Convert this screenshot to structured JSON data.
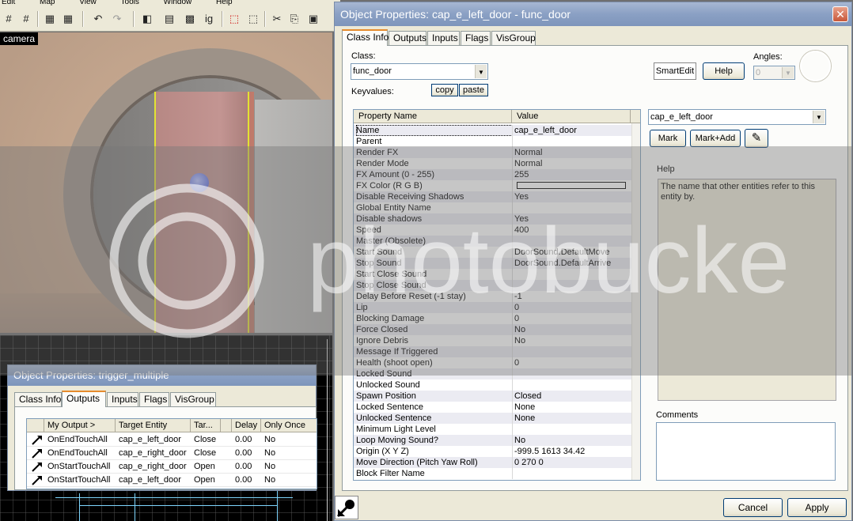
{
  "hammer": {
    "menu": [
      "Edit",
      "Map",
      "View",
      "Tools",
      "Window",
      "Help"
    ],
    "camera_label": "camera"
  },
  "main_dialog": {
    "title": "Object Properties: cap_e_left_door - func_door",
    "tabs": [
      {
        "label": "Class Info",
        "active": true
      },
      {
        "label": "Outputs",
        "active": false
      },
      {
        "label": "Inputs",
        "active": false
      },
      {
        "label": "Flags",
        "active": false
      },
      {
        "label": "VisGroup",
        "active": false
      }
    ],
    "class_label": "Class:",
    "class_value": "func_door",
    "keyvalues_label": "Keyvalues:",
    "copy_label": "copy",
    "paste_label": "paste",
    "smartedit_label": "SmartEdit",
    "help_button_label": "Help",
    "angles_label": "Angles:",
    "angles_value": "0",
    "column_property": "Property Name",
    "column_value": "Value",
    "properties": [
      {
        "name": "Name",
        "value": "cap_e_left_door"
      },
      {
        "name": "Parent",
        "value": ""
      },
      {
        "name": "Render FX",
        "value": "Normal"
      },
      {
        "name": "Render Mode",
        "value": "Normal"
      },
      {
        "name": "FX Amount (0 - 255)",
        "value": "255"
      },
      {
        "name": "FX Color (R G B)",
        "value": ""
      },
      {
        "name": "Disable Receiving Shadows",
        "value": "Yes"
      },
      {
        "name": "Global Entity Name",
        "value": ""
      },
      {
        "name": "Disable shadows",
        "value": "Yes"
      },
      {
        "name": "Speed",
        "value": "400"
      },
      {
        "name": "Master (Obsolete)",
        "value": ""
      },
      {
        "name": "Start Sound",
        "value": "DoorSound.DefaultMove"
      },
      {
        "name": "Stop Sound",
        "value": "DoorSound.DefaultArrive"
      },
      {
        "name": "Start Close Sound",
        "value": ""
      },
      {
        "name": "Stop Close Sound",
        "value": ""
      },
      {
        "name": "Delay Before Reset (-1 stay)",
        "value": "-1"
      },
      {
        "name": "Lip",
        "value": "0"
      },
      {
        "name": "Blocking Damage",
        "value": "0"
      },
      {
        "name": "Force Closed",
        "value": "No"
      },
      {
        "name": "Ignore Debris",
        "value": "No"
      },
      {
        "name": "Message If Triggered",
        "value": ""
      },
      {
        "name": "Health (shoot open)",
        "value": "0"
      },
      {
        "name": "Locked Sound",
        "value": ""
      },
      {
        "name": "Unlocked Sound",
        "value": ""
      },
      {
        "name": "Spawn Position",
        "value": "Closed"
      },
      {
        "name": "Locked Sentence",
        "value": "None"
      },
      {
        "name": "Unlocked Sentence",
        "value": "None"
      },
      {
        "name": "Minimum Light Level",
        "value": ""
      },
      {
        "name": "Loop Moving Sound?",
        "value": "No"
      },
      {
        "name": "Origin (X Y Z)",
        "value": "-999.5 1613 34.42"
      },
      {
        "name": "Move Direction (Pitch Yaw Roll)",
        "value": "0 270 0"
      },
      {
        "name": "Block Filter Name",
        "value": ""
      }
    ],
    "name_combo_value": "cap_e_left_door",
    "mark_label": "Mark",
    "markadd_label": "Mark+Add",
    "help_label": "Help",
    "help_text": "The name that other entities refer to this entity by.",
    "comments_label": "Comments",
    "cancel_label": "Cancel",
    "apply_label": "Apply",
    "colors": {
      "title_start": "#a7b7d2",
      "title_end": "#7e95bb",
      "alt_row": "#ebebf2"
    }
  },
  "trigger_dialog": {
    "title": "Object Properties: trigger_multiple",
    "tabs": [
      {
        "label": "Class Info",
        "active": false
      },
      {
        "label": "Outputs",
        "active": true
      },
      {
        "label": "Inputs",
        "active": false
      },
      {
        "label": "Flags",
        "active": false
      },
      {
        "label": "VisGroup",
        "active": false
      }
    ],
    "columns": [
      "My Output  >",
      "Target Entity",
      "Tar...",
      "Delay",
      "Only Once"
    ],
    "rows": [
      {
        "output": "OnEndTouchAll",
        "target": "cap_e_left_door",
        "input": "Close",
        "delay": "0.00",
        "once": "No"
      },
      {
        "output": "OnEndTouchAll",
        "target": "cap_e_right_door",
        "input": "Close",
        "delay": "0.00",
        "once": "No"
      },
      {
        "output": "OnStartTouchAll",
        "target": "cap_e_right_door",
        "input": "Open",
        "delay": "0.00",
        "once": "No"
      },
      {
        "output": "OnStartTouchAll",
        "target": "cap_e_left_door",
        "input": "Open",
        "delay": "0.00",
        "once": "No"
      }
    ]
  },
  "watermark": {
    "text": "photobucket"
  }
}
